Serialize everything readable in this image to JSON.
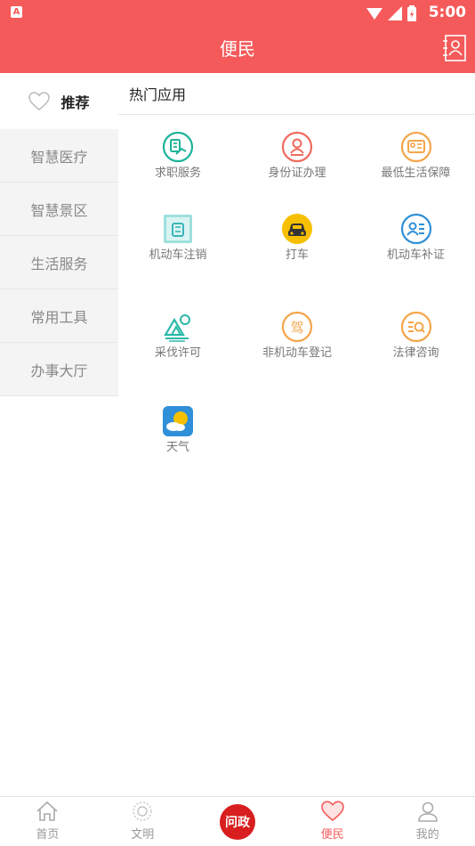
{
  "status_bar": {
    "time": "5:00",
    "indicator": "A"
  },
  "app_bar": {
    "title": "便民",
    "action_icon": "contact-card-icon"
  },
  "sidebar": {
    "items": [
      {
        "label": "推荐",
        "icon": "heart-icon",
        "active": true
      },
      {
        "label": "智慧医疗"
      },
      {
        "label": "智慧景区"
      },
      {
        "label": "生活服务"
      },
      {
        "label": "常用工具"
      },
      {
        "label": "办事大厅"
      }
    ]
  },
  "content": {
    "section_title": "热门应用",
    "apps": [
      {
        "label": "求职服务",
        "icon": "job-icon",
        "color": "#1db39a"
      },
      {
        "label": "身份证办理",
        "icon": "id-card-icon",
        "color": "#f06a5e"
      },
      {
        "label": "最低生活保障",
        "icon": "welfare-icon",
        "color": "#f5a54a"
      },
      {
        "label": "机动车注销",
        "icon": "vehicle-cancel-icon",
        "color": "#5bc6c9"
      },
      {
        "label": "打车",
        "icon": "taxi-icon",
        "color": "#f6c000"
      },
      {
        "label": "机动车补证",
        "icon": "vehicle-license-icon",
        "color": "#2f8fd8"
      },
      {
        "label": "采伐许可",
        "icon": "logging-icon",
        "color": "#2ab8a8"
      },
      {
        "label": "非机动车登记",
        "icon": "non-motor-icon",
        "color": "#f5a54a"
      },
      {
        "label": "法律咨询",
        "icon": "legal-icon",
        "color": "#f5a54a"
      },
      {
        "label": "天气",
        "icon": "weather-icon",
        "color": "#2f8fd8"
      }
    ]
  },
  "bottom_nav": {
    "items": [
      {
        "label": "首页",
        "icon": "home-icon"
      },
      {
        "label": "文明",
        "icon": "civilization-icon"
      },
      {
        "label": "",
        "center_text": "问政",
        "icon": "wenzheng-icon"
      },
      {
        "label": "便民",
        "icon": "heart-icon",
        "active": true
      },
      {
        "label": "我的",
        "icon": "person-icon"
      }
    ]
  },
  "colors": {
    "primary": "#f55a5a",
    "sidebar_bg": "#f4f4f4",
    "center_button": "#d81e1e"
  }
}
